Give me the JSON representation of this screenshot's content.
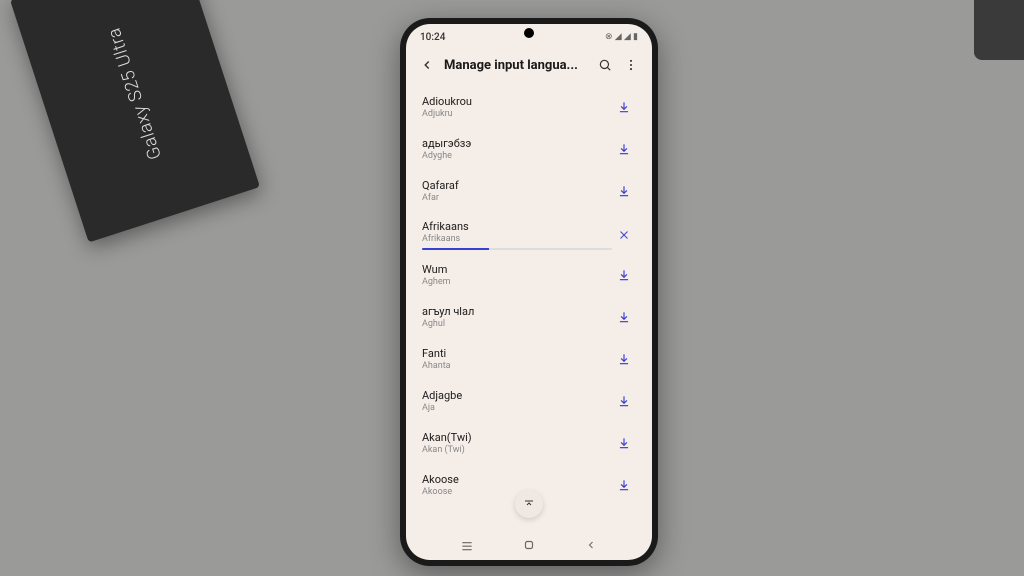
{
  "status": {
    "time": "10:24",
    "icons": "⊗ ◢ ◢ ▮"
  },
  "header": {
    "title": "Manage input langua..."
  },
  "box_label": "Galaxy S25 Ultra",
  "languages": [
    {
      "primary": "Adioukrou",
      "secondary": "Adjukru",
      "state": "download"
    },
    {
      "primary": "адыгэбзэ",
      "secondary": "Adyghe",
      "state": "download"
    },
    {
      "primary": "Qafaraf",
      "secondary": "Afar",
      "state": "download"
    },
    {
      "primary": "Afrikaans",
      "secondary": "Afrikaans",
      "state": "downloading",
      "progress": 35
    },
    {
      "primary": "Wum",
      "secondary": "Aghem",
      "state": "download"
    },
    {
      "primary": "агъул чlал",
      "secondary": "Aghul",
      "state": "download"
    },
    {
      "primary": "Fanti",
      "secondary": "Ahanta",
      "state": "download"
    },
    {
      "primary": "Adjagbe",
      "secondary": "Aja",
      "state": "download"
    },
    {
      "primary": "Akan(Twi)",
      "secondary": "Akan (Twi)",
      "state": "download"
    },
    {
      "primary": "Akoose",
      "secondary": "Akoose",
      "state": "download"
    }
  ]
}
